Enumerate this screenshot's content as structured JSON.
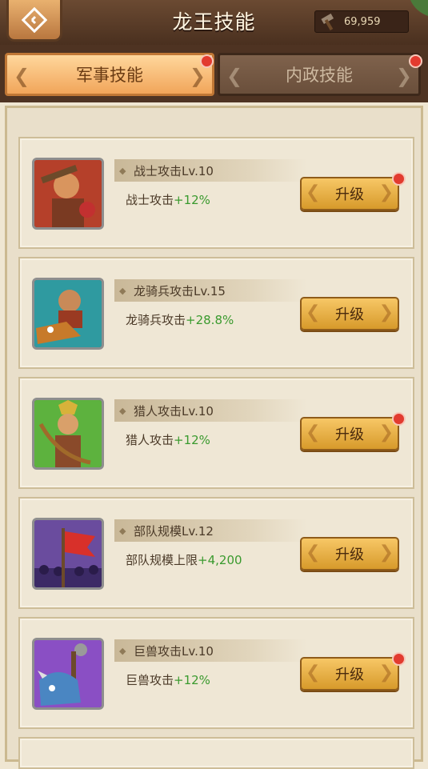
{
  "header": {
    "title": "龙王技能",
    "back_icon": "back-diamond-icon",
    "resource": {
      "icon": "hammer-icon",
      "value": "69,959"
    }
  },
  "tabs": [
    {
      "label": "军事技能",
      "active": true,
      "badge": true
    },
    {
      "label": "内政技能",
      "active": false,
      "badge": true
    }
  ],
  "skills": [
    {
      "name": "战士攻击Lv.10",
      "effect_label": "战士攻击",
      "effect_value": "+12%",
      "button": "升级",
      "badge": true,
      "portrait": "warrior-portrait"
    },
    {
      "name": "龙骑兵攻击Lv.15",
      "effect_label": "龙骑兵攻击",
      "effect_value": "+28.8%",
      "button": "升级",
      "badge": false,
      "portrait": "dragoon-portrait"
    },
    {
      "name": "猎人攻击Lv.10",
      "effect_label": "猎人攻击",
      "effect_value": "+12%",
      "button": "升级",
      "badge": true,
      "portrait": "hunter-portrait"
    },
    {
      "name": "部队规模Lv.12",
      "effect_label": "部队规模上限",
      "effect_value": "+4,200",
      "button": "升级",
      "badge": false,
      "portrait": "troop-banner-portrait"
    },
    {
      "name": "巨兽攻击Lv.10",
      "effect_label": "巨兽攻击",
      "effect_value": "+12%",
      "button": "升级",
      "badge": true,
      "portrait": "beast-portrait"
    }
  ],
  "colors": {
    "accent": "#f1a55a",
    "bonus": "#3a9a2e",
    "badge": "#e23b2f"
  }
}
